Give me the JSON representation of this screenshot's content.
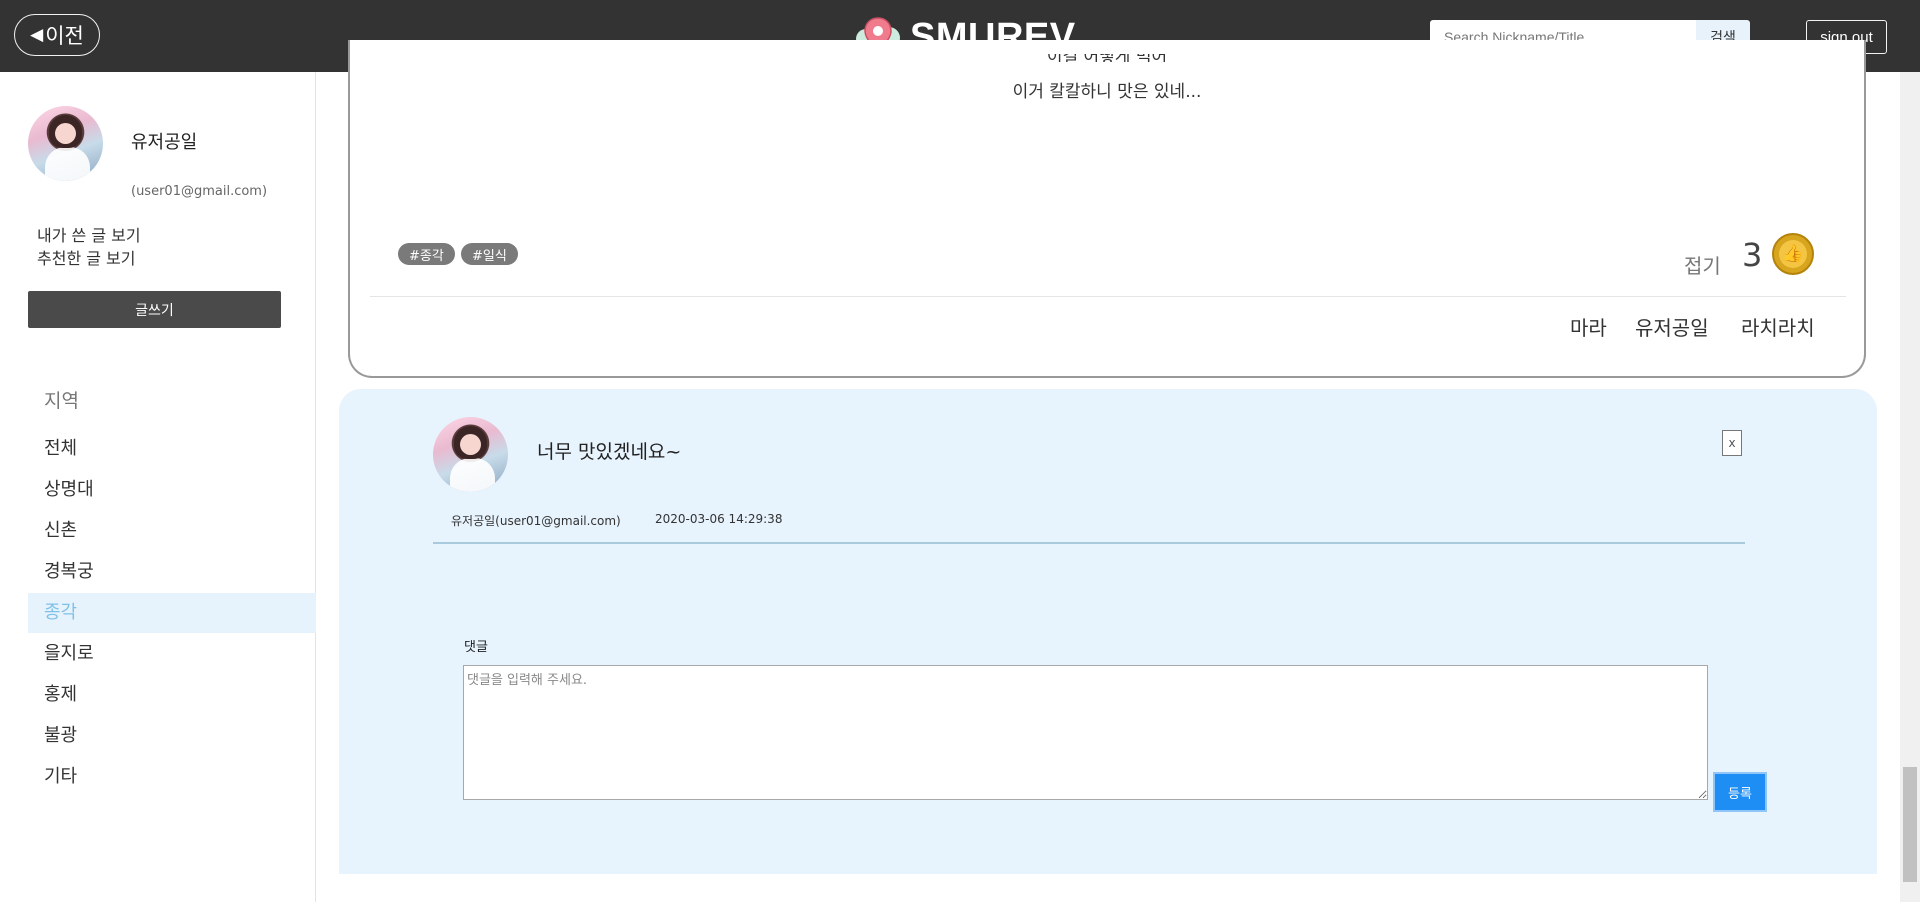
{
  "header": {
    "back_label": "이전",
    "brand": "SMUREV",
    "search_placeholder": "Search Nickname/Title",
    "search_button": "검색",
    "signout_label": "sign out"
  },
  "sidebar": {
    "username": "유저공일",
    "email": "(user01@gmail.com)",
    "links": [
      "내가 쓴 글 보기",
      "추천한 글 보기"
    ],
    "write_button": "글쓰기",
    "region_title": "지역",
    "regions": [
      "전체",
      "상명대",
      "신촌",
      "경복궁",
      "종각",
      "을지로",
      "홍제",
      "불광",
      "기타"
    ],
    "active_region": "종각"
  },
  "post": {
    "text_partial": "이걸 어떻게 먹어",
    "text_line": "이거 칼칼하니 맛은 있네...",
    "tags": [
      "#종각",
      "#일식"
    ],
    "collapse_label": "접기",
    "like_count": "3",
    "likers": [
      "마라",
      "유저공일",
      "라치라치"
    ]
  },
  "comment": {
    "text": "너무 맛있겠네요~",
    "close_label": "x",
    "author": "유저공일(user01@gmail.com)",
    "timestamp": "2020-03-06 14:29:38"
  },
  "reply": {
    "label": "댓글",
    "placeholder": "댓글을 입력해 주세요.",
    "submit_label": "등록"
  },
  "colors": {
    "topbar": "#333333",
    "active_region_bg": "#e7f3fc",
    "active_region_text": "#7ec0ea",
    "comment_bg": "#e7f3fd",
    "submit_button": "#1e8ef5"
  }
}
